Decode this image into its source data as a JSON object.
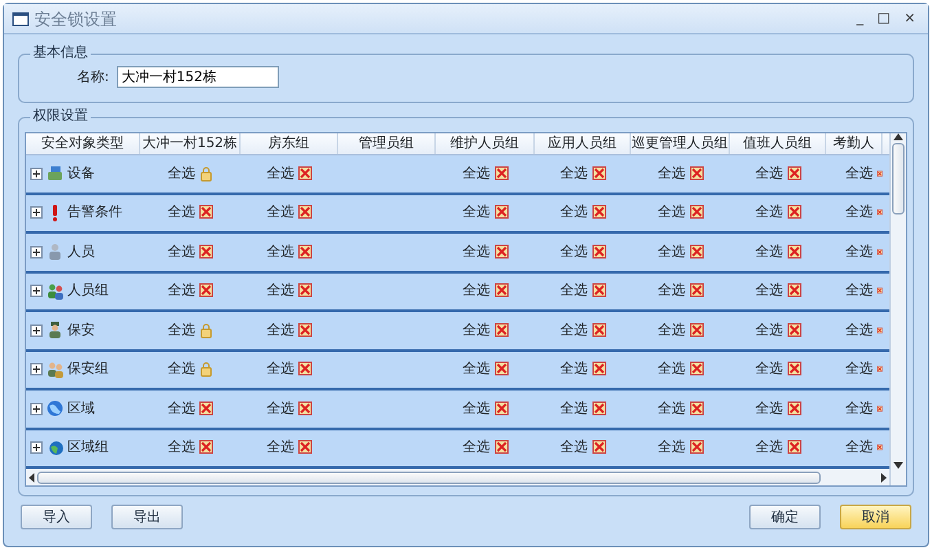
{
  "window": {
    "title": "安全锁设置",
    "controls": [
      "_",
      "□",
      "×"
    ]
  },
  "basic_info": {
    "legend": "基本信息",
    "name_label": "名称:",
    "name_value": "大冲一村152栋"
  },
  "permissions": {
    "legend": "权限设置",
    "columns": [
      "安全对象类型",
      "大冲一村152栋",
      "房东组",
      "管理员组",
      "维护人员组",
      "应用人员组",
      "巡更管理人员组",
      "值班人员组",
      "考勤人"
    ],
    "rows": [
      {
        "cells": [
          {
            "kind": "device",
            "text": "设备"
          },
          {
            "text": "全选",
            "granted": true
          },
          {
            "text": "全选",
            "granted": false
          },
          "",
          {
            "text": "全选",
            "granted": false
          },
          {
            "text": "全选",
            "granted": false
          },
          {
            "text": "全选",
            "granted": false
          },
          {
            "text": "全选",
            "granted": false
          },
          {
            "text": "全选",
            "granted": false
          }
        ]
      },
      {
        "cells": [
          {
            "kind": "alert",
            "text": "告警条件"
          },
          {
            "text": "全选",
            "granted": false
          },
          {
            "text": "全选",
            "granted": false
          },
          "",
          {
            "text": "全选",
            "granted": false
          },
          {
            "text": "全选",
            "granted": false
          },
          {
            "text": "全选",
            "granted": false
          },
          {
            "text": "全选",
            "granted": false
          },
          {
            "text": "全选",
            "granted": false
          }
        ]
      },
      {
        "cells": [
          {
            "kind": "person",
            "text": "人员"
          },
          {
            "text": "全选",
            "granted": false
          },
          {
            "text": "全选",
            "granted": false
          },
          "",
          {
            "text": "全选",
            "granted": false
          },
          {
            "text": "全选",
            "granted": false
          },
          {
            "text": "全选",
            "granted": false
          },
          {
            "text": "全选",
            "granted": false
          },
          {
            "text": "全选",
            "granted": false
          }
        ]
      },
      {
        "cells": [
          {
            "kind": "people",
            "text": "人员组"
          },
          {
            "text": "全选",
            "granted": false
          },
          {
            "text": "全选",
            "granted": false
          },
          "",
          {
            "text": "全选",
            "granted": false
          },
          {
            "text": "全选",
            "granted": false
          },
          {
            "text": "全选",
            "granted": false
          },
          {
            "text": "全选",
            "granted": false
          },
          {
            "text": "全选",
            "granted": false
          }
        ]
      },
      {
        "cells": [
          {
            "kind": "guard",
            "text": "保安"
          },
          {
            "text": "全选",
            "granted": true
          },
          {
            "text": "全选",
            "granted": false
          },
          "",
          {
            "text": "全选",
            "granted": false
          },
          {
            "text": "全选",
            "granted": false
          },
          {
            "text": "全选",
            "granted": false
          },
          {
            "text": "全选",
            "granted": false
          },
          {
            "text": "全选",
            "granted": false
          }
        ]
      },
      {
        "cells": [
          {
            "kind": "guards",
            "text": "保安组"
          },
          {
            "text": "全选",
            "granted": true
          },
          {
            "text": "全选",
            "granted": false
          },
          "",
          {
            "text": "全选",
            "granted": false
          },
          {
            "text": "全选",
            "granted": false
          },
          {
            "text": "全选",
            "granted": false
          },
          {
            "text": "全选",
            "granted": false
          },
          {
            "text": "全选",
            "granted": false
          }
        ]
      },
      {
        "cells": [
          {
            "kind": "globe",
            "text": "区域"
          },
          {
            "text": "全选",
            "granted": false
          },
          {
            "text": "全选",
            "granted": false
          },
          "",
          {
            "text": "全选",
            "granted": false
          },
          {
            "text": "全选",
            "granted": false
          },
          {
            "text": "全选",
            "granted": false
          },
          {
            "text": "全选",
            "granted": false
          },
          {
            "text": "全选",
            "granted": false
          }
        ]
      },
      {
        "cells": [
          {
            "kind": "globes",
            "text": "区域组"
          },
          {
            "text": "全选",
            "granted": false
          },
          {
            "text": "全选",
            "granted": false
          },
          "",
          {
            "text": "全选",
            "granted": false
          },
          {
            "text": "全选",
            "granted": false
          },
          {
            "text": "全选",
            "granted": false
          },
          {
            "text": "全选",
            "granted": false
          },
          {
            "text": "全选",
            "granted": false
          }
        ]
      }
    ]
  },
  "buttons": [
    {
      "label": "导入",
      "kind": "normal"
    },
    {
      "label": "导出",
      "kind": "normal"
    },
    {
      "label": "确定",
      "kind": "normal"
    },
    {
      "label": "取消",
      "kind": "primary"
    }
  ]
}
